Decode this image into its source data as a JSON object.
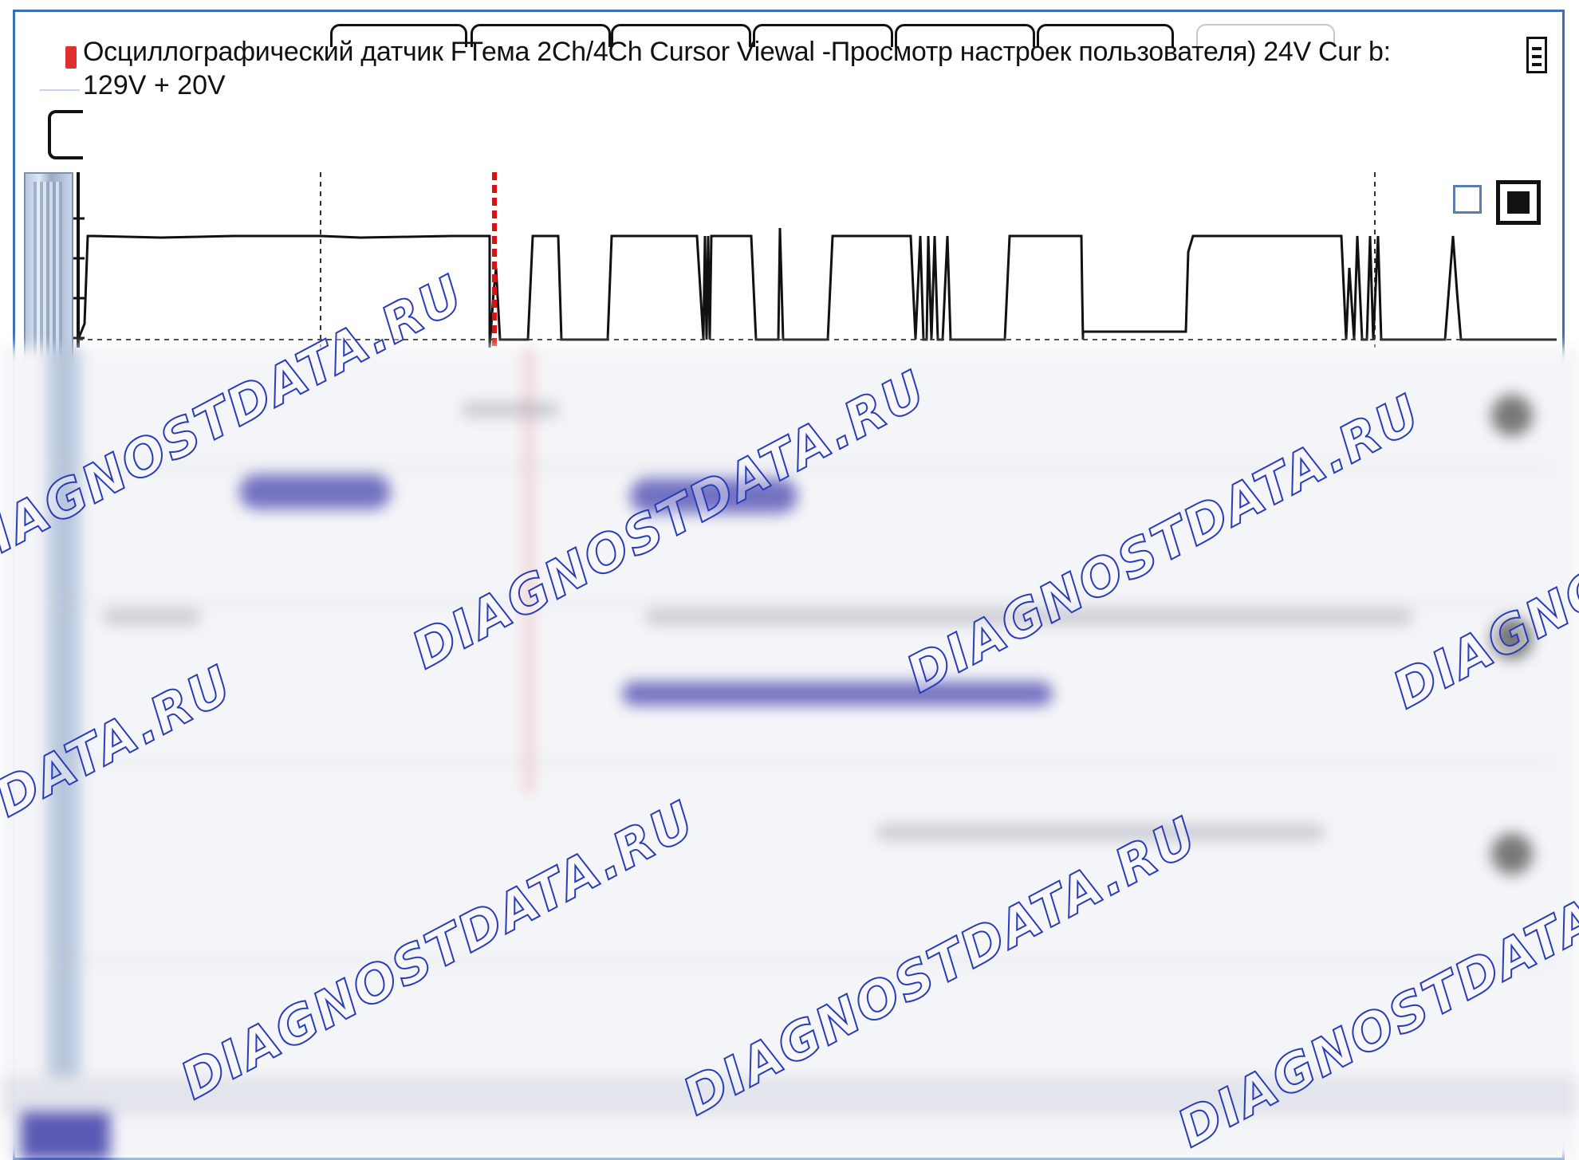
{
  "window": {
    "title": "Осциллографический датчик FТема 2Ch/4Ch      Cursor Viewal -Просмотр настроек пользователя) 24V Cur b:",
    "scale_text": "129V + 20V"
  },
  "icons": {
    "window_icon": "app-icon",
    "menu_icon": "menu-icon",
    "view_single": "single-view-icon",
    "view_filled": "filled-view-icon"
  },
  "colors": {
    "frame": "#3b6fb6",
    "trace": "#111111",
    "cursor": "#e01010",
    "watermark": "#2a3db8"
  },
  "scope": {
    "cursor_label": "",
    "cursor_time_fraction": 0.31,
    "trace_levels": {
      "high": 0.86,
      "low": 0.02,
      "mid": 0.26
    }
  },
  "watermark": {
    "text": "DIAGNOSTDATA.RU"
  }
}
